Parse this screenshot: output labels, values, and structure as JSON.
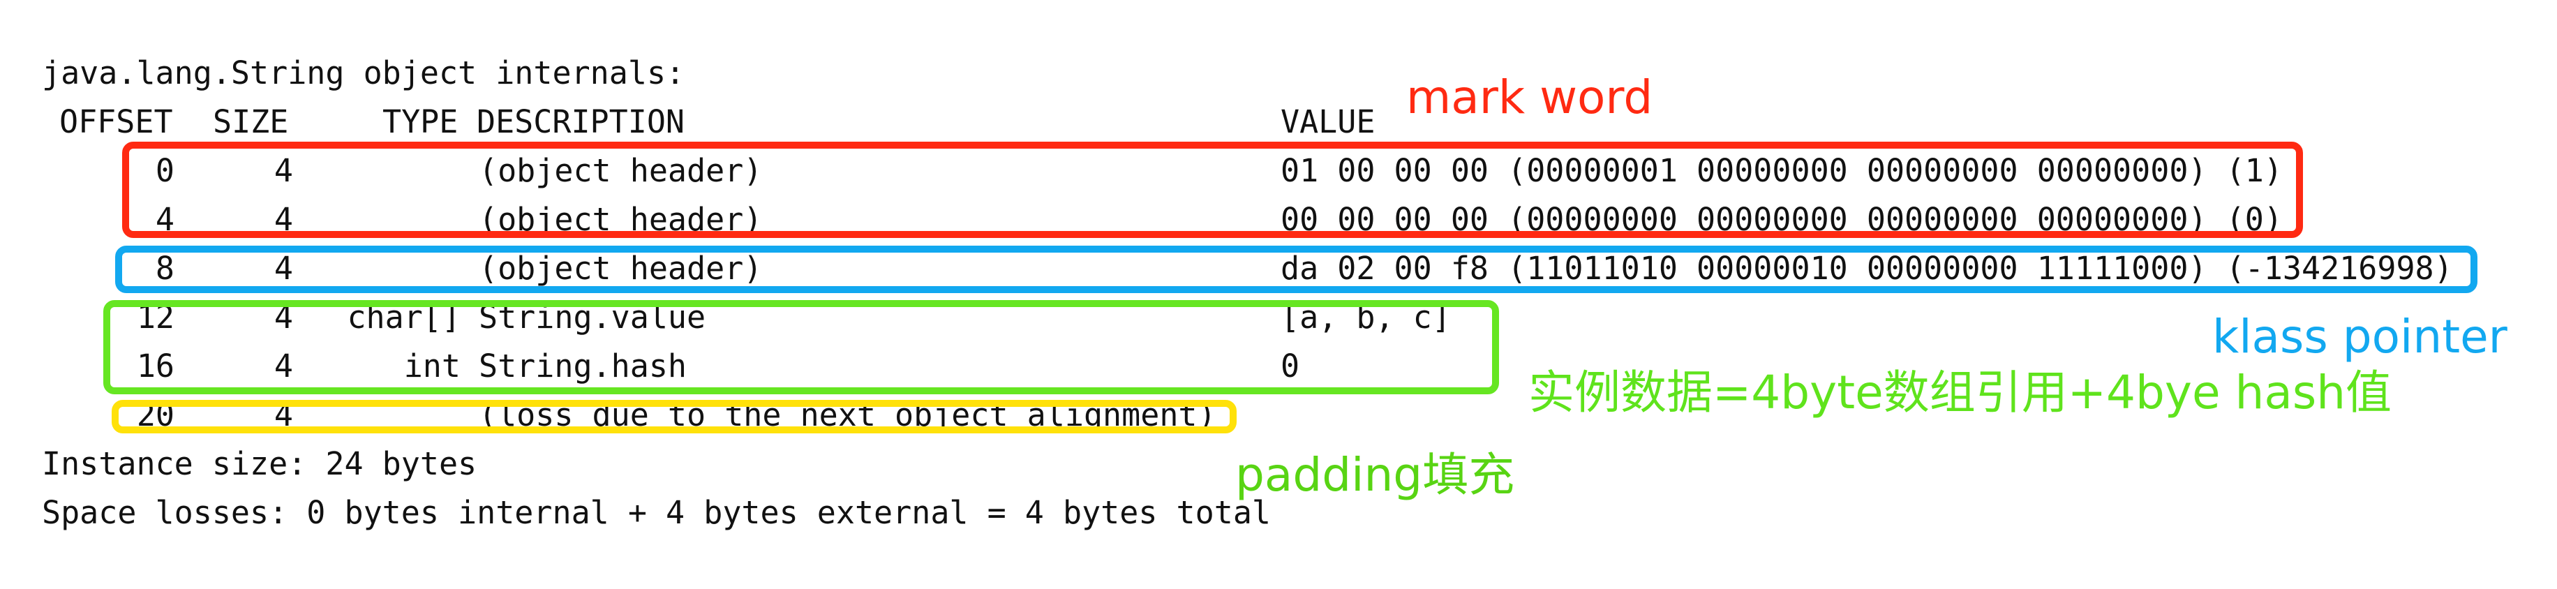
{
  "listing": {
    "title": "java.lang.String object internals:",
    "header": {
      "offset": "OFFSET",
      "size": "SIZE",
      "type": "TYPE",
      "description": "DESCRIPTION",
      "value": "VALUE"
    },
    "rows": [
      {
        "offset": "0",
        "size": "4",
        "type": "",
        "description": "(object header)",
        "value": "01 00 00 00 (00000001 00000000 00000000 00000000) (1)"
      },
      {
        "offset": "4",
        "size": "4",
        "type": "",
        "description": "(object header)",
        "value": "00 00 00 00 (00000000 00000000 00000000 00000000) (0)"
      },
      {
        "offset": "8",
        "size": "4",
        "type": "",
        "description": "(object header)",
        "value": "da 02 00 f8 (11011010 00000010 00000000 11111000) (-134216998)"
      },
      {
        "offset": "12",
        "size": "4",
        "type": "char[]",
        "description": "String.value",
        "value": "[a, b, c]"
      },
      {
        "offset": "16",
        "size": "4",
        "type": "int",
        "description": "String.hash",
        "value": "0"
      },
      {
        "offset": "20",
        "size": "4",
        "type": "",
        "description": "(loss due to the next object alignment)",
        "value": ""
      }
    ],
    "instance_size": "Instance size: 24 bytes",
    "space_losses": "Space losses: 0 bytes internal + 4 bytes external = 4 bytes total"
  },
  "annotations": {
    "mark_word": {
      "label": "mark word",
      "color": "#ff2a12"
    },
    "klass_pointer": {
      "label": "klass pointer",
      "color": "#12a8f0"
    },
    "instance_data": {
      "label": "实例数据=4byte数组引用+4bye hash值",
      "color": "#5fe31c"
    },
    "padding": {
      "label": "padding填充",
      "color": "#58d413"
    }
  },
  "box_colors": {
    "mark_word": "#ff2a12",
    "klass_pointer": "#12a8f0",
    "instance_data": "#66e622",
    "padding": "#ffe10a"
  }
}
